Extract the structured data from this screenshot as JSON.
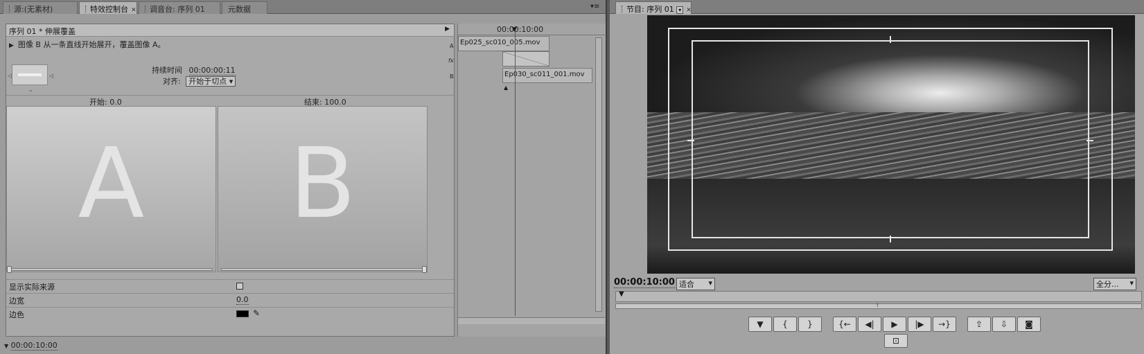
{
  "left_tabs": [
    {
      "label": "源:(无素材)"
    },
    {
      "label": "特效控制台",
      "active": true
    },
    {
      "label": "调音台: 序列 01"
    },
    {
      "label": "元数据"
    }
  ],
  "effect_controls": {
    "header": "序列 01 * 伸展覆盖",
    "description": "图像 B 从一条直线开始展开，覆盖图像 A。",
    "duration_label": "持续时间",
    "duration_value": "00:00:00:11",
    "align_label": "对齐:",
    "align_value": "开始于切点",
    "start_label": "开始:",
    "start_value": "0.0",
    "end_label": "结束:",
    "end_value": "100.0",
    "preview_a": "A",
    "preview_b": "B",
    "show_source_label": "显示实际来源",
    "border_width_label": "边宽",
    "border_width_value": "0.0",
    "border_color_label": "边色",
    "border_color": "#000000",
    "footer_time": "00:00:10:00"
  },
  "mini_timeline": {
    "time": "00:00:10:00",
    "track_a": "A",
    "track_fx": "fx",
    "track_b": "B",
    "clip_a": "Ep025_sc010_005.mov",
    "clip_b": "Ep030_sc011_001.mov"
  },
  "program_monitor": {
    "tab_label": "节目: 序列 01",
    "timecode": "00:00:10:00",
    "zoom": "适合",
    "quality": "全分..."
  },
  "transport_buttons": [
    {
      "name": "set-marker",
      "glyph": "▼"
    },
    {
      "name": "mark-in",
      "glyph": "{"
    },
    {
      "name": "mark-out",
      "glyph": "}"
    },
    {
      "name": "go-to-in",
      "glyph": "{←"
    },
    {
      "name": "step-back",
      "glyph": "◀|"
    },
    {
      "name": "play",
      "glyph": "▶"
    },
    {
      "name": "step-forward",
      "glyph": "|▶"
    },
    {
      "name": "go-to-out",
      "glyph": "→}"
    },
    {
      "name": "lift",
      "glyph": "⇪"
    },
    {
      "name": "extract",
      "glyph": "⇩"
    },
    {
      "name": "export-frame",
      "glyph": "◙"
    }
  ],
  "colors": {
    "panel_bg": "#9c9c9c",
    "monitor_bg": "#222222",
    "safe_margin": "#e6e6e6"
  }
}
